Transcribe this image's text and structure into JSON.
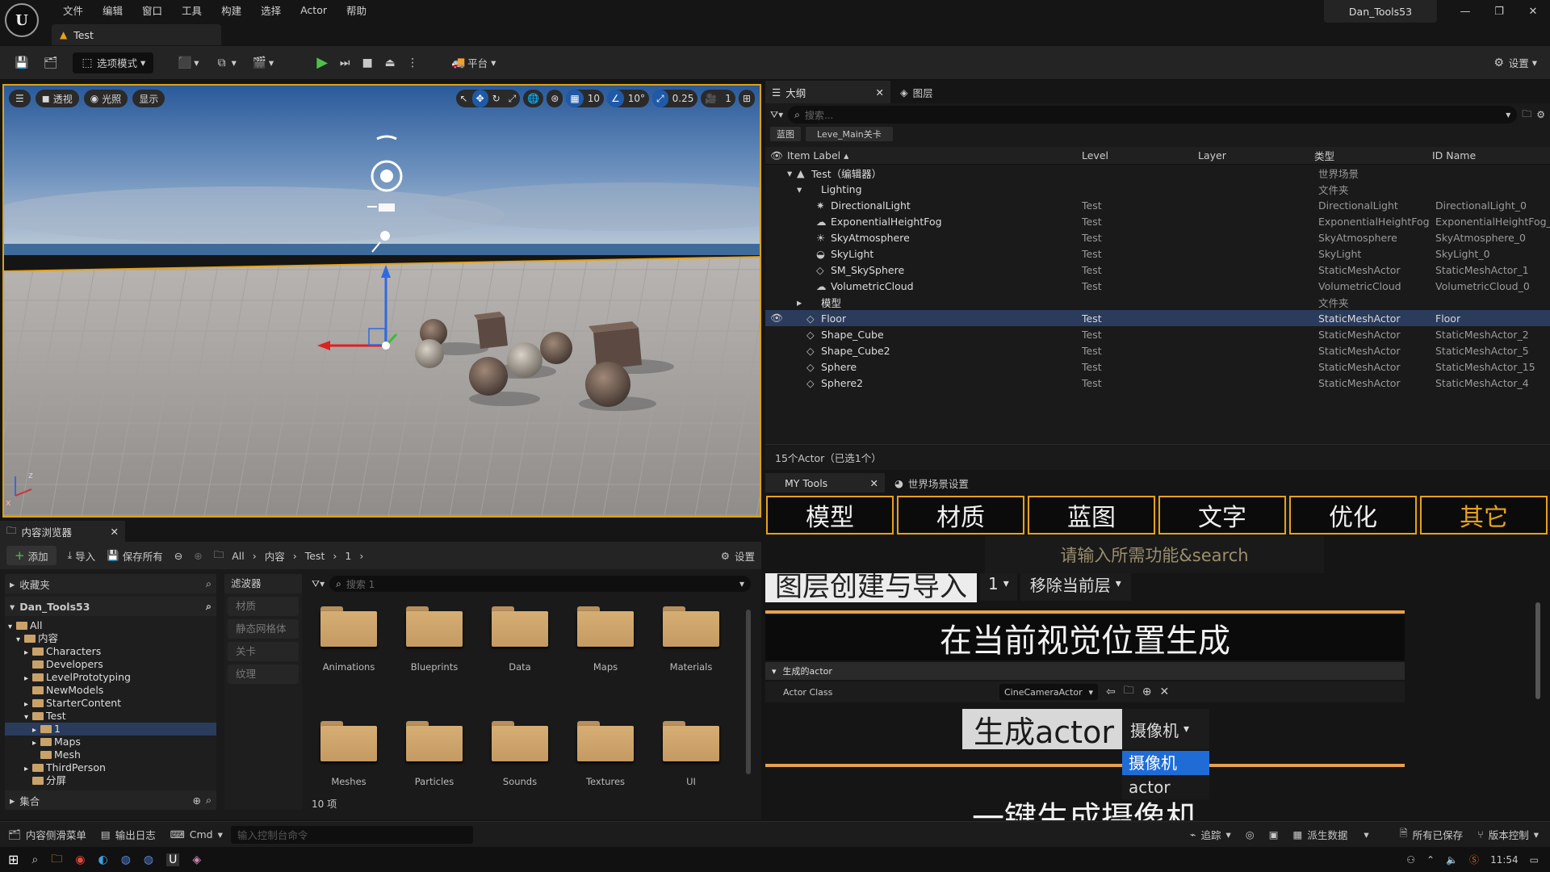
{
  "app": {
    "menus": [
      "文件",
      "编辑",
      "窗口",
      "工具",
      "构建",
      "选择",
      "Actor",
      "帮助"
    ],
    "project_name": "Dan_Tools53",
    "level_tab": "Test"
  },
  "toolbar": {
    "mode": "选项模式",
    "platform": "平台",
    "settings": "设置"
  },
  "viewport": {
    "perspective": "透视",
    "lit": "光照",
    "show": "显示",
    "grid": "10",
    "angle": "10°",
    "scale": "0.25",
    "camera_speed": "1"
  },
  "outliner": {
    "tab_label": "大纲",
    "tab_layers": "图层",
    "search_placeholder": "搜索...",
    "chips": [
      "蓝图",
      "Leve_Main关卡"
    ],
    "columns": {
      "label": "Item Label ▴",
      "level": "Level",
      "layer": "Layer",
      "type": "类型",
      "id": "ID Name"
    },
    "rows": [
      {
        "label": "Test（编辑器）",
        "level": "",
        "type": "世界场景",
        "id": "",
        "depth": 1,
        "expand": "▾",
        "icon": "level"
      },
      {
        "label": "Lighting",
        "level": "",
        "type": "文件夹",
        "id": "",
        "depth": 2,
        "expand": "▾",
        "icon": "folder"
      },
      {
        "label": "DirectionalLight",
        "level": "Test",
        "type": "DirectionalLight",
        "id": "DirectionalLight_0",
        "depth": 3,
        "expand": "",
        "icon": "sun"
      },
      {
        "label": "ExponentialHeightFog",
        "level": "Test",
        "type": "ExponentialHeightFog",
        "id": "ExponentialHeightFog_0",
        "depth": 3,
        "expand": "",
        "icon": "fog"
      },
      {
        "label": "SkyAtmosphere",
        "level": "Test",
        "type": "SkyAtmosphere",
        "id": "SkyAtmosphere_0",
        "depth": 3,
        "expand": "",
        "icon": "sky"
      },
      {
        "label": "SkyLight",
        "level": "Test",
        "type": "SkyLight",
        "id": "SkyLight_0",
        "depth": 3,
        "expand": "",
        "icon": "skylight"
      },
      {
        "label": "SM_SkySphere",
        "level": "Test",
        "type": "StaticMeshActor",
        "id": "StaticMeshActor_1",
        "depth": 3,
        "expand": "",
        "icon": "mesh"
      },
      {
        "label": "VolumetricCloud",
        "level": "Test",
        "type": "VolumetricCloud",
        "id": "VolumetricCloud_0",
        "depth": 3,
        "expand": "",
        "icon": "cloud"
      },
      {
        "label": "模型",
        "level": "",
        "type": "文件夹",
        "id": "",
        "depth": 2,
        "expand": "▸",
        "icon": "folder"
      },
      {
        "label": "Floor",
        "level": "Test",
        "type": "StaticMeshActor",
        "id": "Floor",
        "depth": 2,
        "expand": "",
        "icon": "mesh",
        "selected": true
      },
      {
        "label": "Shape_Cube",
        "level": "Test",
        "type": "StaticMeshActor",
        "id": "StaticMeshActor_2",
        "depth": 2,
        "expand": "",
        "icon": "mesh"
      },
      {
        "label": "Shape_Cube2",
        "level": "Test",
        "type": "StaticMeshActor",
        "id": "StaticMeshActor_5",
        "depth": 2,
        "expand": "",
        "icon": "mesh"
      },
      {
        "label": "Sphere",
        "level": "Test",
        "type": "StaticMeshActor",
        "id": "StaticMeshActor_15",
        "depth": 2,
        "expand": "",
        "icon": "mesh"
      },
      {
        "label": "Sphere2",
        "level": "Test",
        "type": "StaticMeshActor",
        "id": "StaticMeshActor_4",
        "depth": 2,
        "expand": "",
        "icon": "mesh"
      }
    ],
    "footer": "15个Actor（已选1个）"
  },
  "content_browser": {
    "tab": "内容浏览器",
    "add": "添加",
    "import": "导入",
    "save_all": "保存所有",
    "breadcrumb": [
      "All",
      "内容",
      "Test",
      "1"
    ],
    "settings": "设置",
    "favorites": "收藏夹",
    "project": "Dan_Tools53",
    "tree": [
      {
        "label": "All",
        "depth": 0,
        "expand": "▾"
      },
      {
        "label": "内容",
        "depth": 1,
        "expand": "▾"
      },
      {
        "label": "Characters",
        "depth": 2,
        "expand": "▸"
      },
      {
        "label": "Developers",
        "depth": 2,
        "expand": ""
      },
      {
        "label": "LevelPrototyping",
        "depth": 2,
        "expand": "▸"
      },
      {
        "label": "NewModels",
        "depth": 2,
        "expand": ""
      },
      {
        "label": "StarterContent",
        "depth": 2,
        "expand": "▸"
      },
      {
        "label": "Test",
        "depth": 2,
        "expand": "▾"
      },
      {
        "label": "1",
        "depth": 3,
        "expand": "▸",
        "selected": true
      },
      {
        "label": "Maps",
        "depth": 3,
        "expand": "▸"
      },
      {
        "label": "Mesh",
        "depth": 3,
        "expand": ""
      },
      {
        "label": "ThirdPerson",
        "depth": 2,
        "expand": "▸"
      },
      {
        "label": "分屏",
        "depth": 2,
        "expand": ""
      }
    ],
    "collections": "集合",
    "filters_title": "滤波器",
    "filters": [
      "材质",
      "静态网格体",
      "关卡",
      "纹理"
    ],
    "search_placeholder": "搜索 1",
    "folders": [
      "Animations",
      "Blueprints",
      "Data",
      "Maps",
      "Materials",
      "Meshes",
      "Particles",
      "Sounds",
      "Textures",
      "UI"
    ],
    "count": "10 项"
  },
  "my_tools": {
    "tab": "MY Tools",
    "tab2": "世界场景设置",
    "categories": [
      "模型",
      "材质",
      "蓝图",
      "文字",
      "优化",
      "其它"
    ],
    "search_placeholder": "请输入所需功能&search",
    "layer_title": "图层创建与导入",
    "layer_value": "1",
    "remove_layer": "移除当前层",
    "spawn_title": "在当前视觉位置生成",
    "section": "生成的actor",
    "actor_class_label": "Actor Class",
    "actor_class_value": "CineCameraActor",
    "spawn_button": "生成actor",
    "spawn_select": "摄像机",
    "dropdown": [
      "摄像机",
      "actor"
    ],
    "next_title": "一键生成摄像机"
  },
  "statusbar": {
    "drawer": "内容侧滑菜单",
    "output_log": "输出日志",
    "cmd": "Cmd",
    "console_placeholder": "输入控制台命令",
    "trace": "追踪",
    "derived": "派生数据",
    "saved": "所有已保存",
    "vcs": "版本控制"
  },
  "taskbar": {
    "time": "11:54"
  },
  "colors": {
    "accent": "#e6a21a",
    "selection": "#2a3b5c",
    "blue": "#1f5aa8"
  }
}
